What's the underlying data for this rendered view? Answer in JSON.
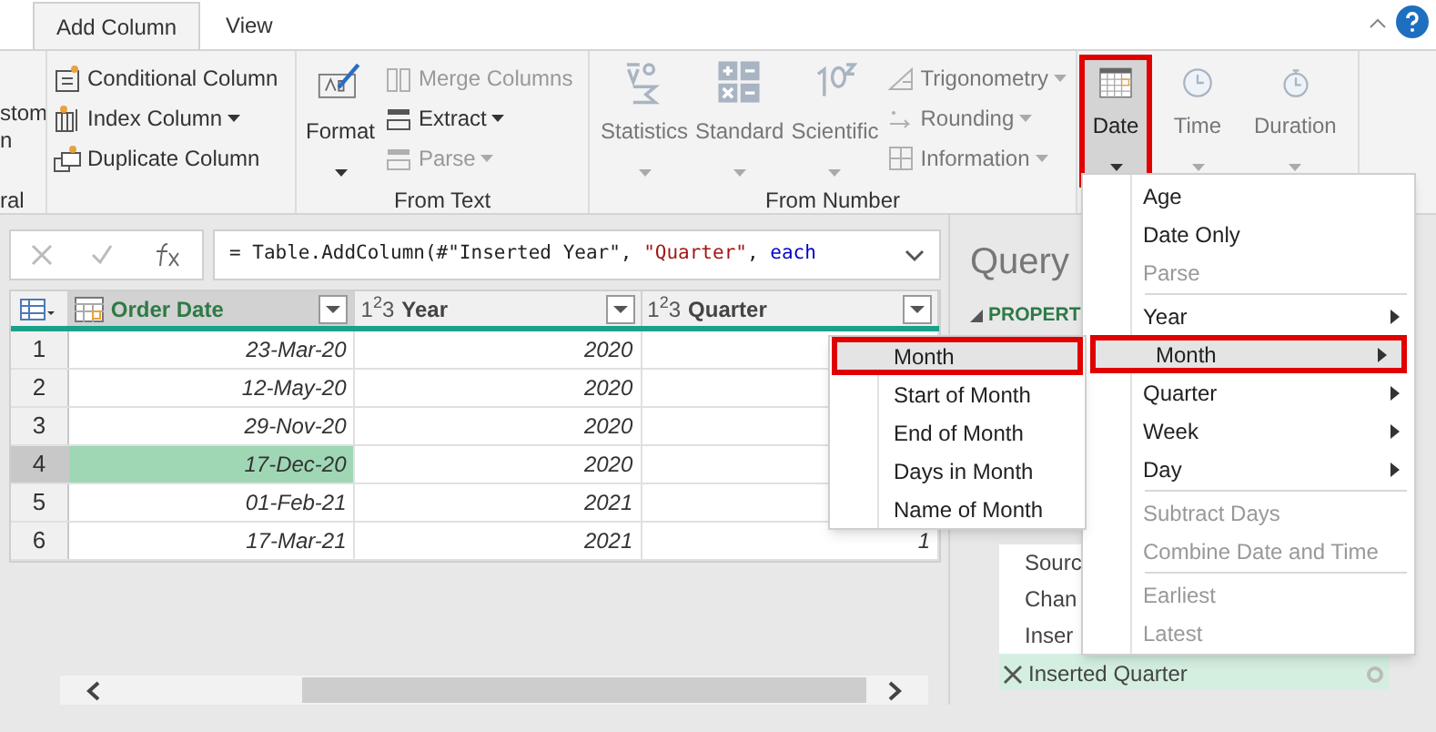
{
  "tabs": [
    {
      "label": "Add Column",
      "selected": true
    },
    {
      "label": "View",
      "selected": false
    }
  ],
  "ribbon": {
    "general": {
      "button_text": [
        "stom",
        "n"
      ],
      "label": "ral"
    },
    "custom_group": {
      "items": [
        {
          "label": "Conditional Column",
          "dropdown": false
        },
        {
          "label": "Index Column",
          "dropdown": true
        },
        {
          "label": "Duplicate Column",
          "dropdown": false
        }
      ]
    },
    "from_text": {
      "label": "From Text",
      "big": {
        "label": "Format",
        "dropdown": true
      },
      "items": [
        {
          "label": "Merge Columns",
          "disabled": true,
          "dropdown": false
        },
        {
          "label": "Extract",
          "disabled": false,
          "dropdown": true
        },
        {
          "label": "Parse",
          "disabled": true,
          "dropdown": true
        }
      ]
    },
    "from_number": {
      "label": "From Number",
      "big": [
        {
          "label": "Statistics",
          "dropdown": true
        },
        {
          "label": "Standard",
          "dropdown": true
        },
        {
          "label": "Scientific",
          "dropdown": true
        }
      ],
      "items": [
        {
          "label": "Trigonometry"
        },
        {
          "label": "Rounding"
        },
        {
          "label": "Information"
        }
      ]
    },
    "date_time": [
      {
        "label": "Date",
        "selected": true,
        "disabled": false
      },
      {
        "label": "Time",
        "selected": false,
        "disabled": true
      },
      {
        "label": "Duration",
        "selected": false,
        "disabled": true
      }
    ]
  },
  "formula": {
    "parts": [
      {
        "kind": "plain",
        "text": "= Table.AddColumn(#\"Inserted Year\", "
      },
      {
        "kind": "string",
        "text": "\"Quarter\""
      },
      {
        "kind": "plain",
        "text": ", "
      },
      {
        "kind": "keyword",
        "text": "each"
      }
    ]
  },
  "table": {
    "columns": [
      {
        "label": "Order Date",
        "selected": true
      },
      {
        "label": "Year",
        "type_badge": "1$^{2}$3",
        "selected": false
      },
      {
        "label": "Quarter",
        "type_badge": "1$^{2}$3",
        "selected": false
      }
    ],
    "rows": [
      {
        "num": "1",
        "selected": false,
        "cells": [
          "23-Mar-20",
          "2020"
        ]
      },
      {
        "num": "2",
        "selected": false,
        "cells": [
          "12-May-20",
          "2020"
        ]
      },
      {
        "num": "3",
        "selected": false,
        "cells": [
          "29-Nov-20",
          "2020"
        ]
      },
      {
        "num": "4",
        "selected": true,
        "cells": [
          "17-Dec-20",
          "2020"
        ]
      },
      {
        "num": "5",
        "selected": false,
        "cells": [
          "01-Feb-21",
          "2021"
        ]
      },
      {
        "num": "6",
        "selected": false,
        "cells": [
          "17-Mar-21",
          "2021",
          "1"
        ]
      }
    ]
  },
  "query_pane": {
    "title": "Query",
    "section": "PROPERT",
    "steps": [
      {
        "label": "Sourc",
        "selected": false
      },
      {
        "label": "Chan",
        "selected": false
      },
      {
        "label": "Inser",
        "selected": false
      },
      {
        "label": "Inserted Quarter",
        "selected": true
      }
    ]
  },
  "date_menu": {
    "items": [
      {
        "kind": "item",
        "label": "Age",
        "disabled": false,
        "submenu": false,
        "selected": false
      },
      {
        "kind": "item",
        "label": "Date Only",
        "disabled": false,
        "submenu": false,
        "selected": false
      },
      {
        "kind": "item",
        "label": "Parse",
        "disabled": true,
        "submenu": false,
        "selected": false
      },
      {
        "kind": "separator"
      },
      {
        "kind": "item",
        "label": "Year",
        "disabled": false,
        "submenu": true,
        "selected": false
      },
      {
        "kind": "item",
        "label": "Month",
        "disabled": false,
        "submenu": true,
        "selected": true
      },
      {
        "kind": "item",
        "label": "Quarter",
        "disabled": false,
        "submenu": true,
        "selected": false
      },
      {
        "kind": "item",
        "label": "Week",
        "disabled": false,
        "submenu": true,
        "selected": false
      },
      {
        "kind": "item",
        "label": "Day",
        "disabled": false,
        "submenu": true,
        "selected": false
      },
      {
        "kind": "separator"
      },
      {
        "kind": "item",
        "label": "Subtract Days",
        "disabled": true,
        "submenu": false,
        "selected": false
      },
      {
        "kind": "item",
        "label": "Combine Date and Time",
        "disabled": true,
        "submenu": false,
        "selected": false
      },
      {
        "kind": "separator"
      },
      {
        "kind": "item",
        "label": "Earliest",
        "disabled": true,
        "submenu": false,
        "selected": false
      },
      {
        "kind": "item",
        "label": "Latest",
        "disabled": true,
        "submenu": false,
        "selected": false
      }
    ]
  },
  "month_submenu": {
    "items": [
      {
        "label": "Month",
        "selected": true
      },
      {
        "label": "Start of Month",
        "selected": false
      },
      {
        "label": "End of Month",
        "selected": false
      },
      {
        "label": "Days in Month",
        "selected": false
      },
      {
        "label": "Name of Month",
        "selected": false
      }
    ]
  }
}
